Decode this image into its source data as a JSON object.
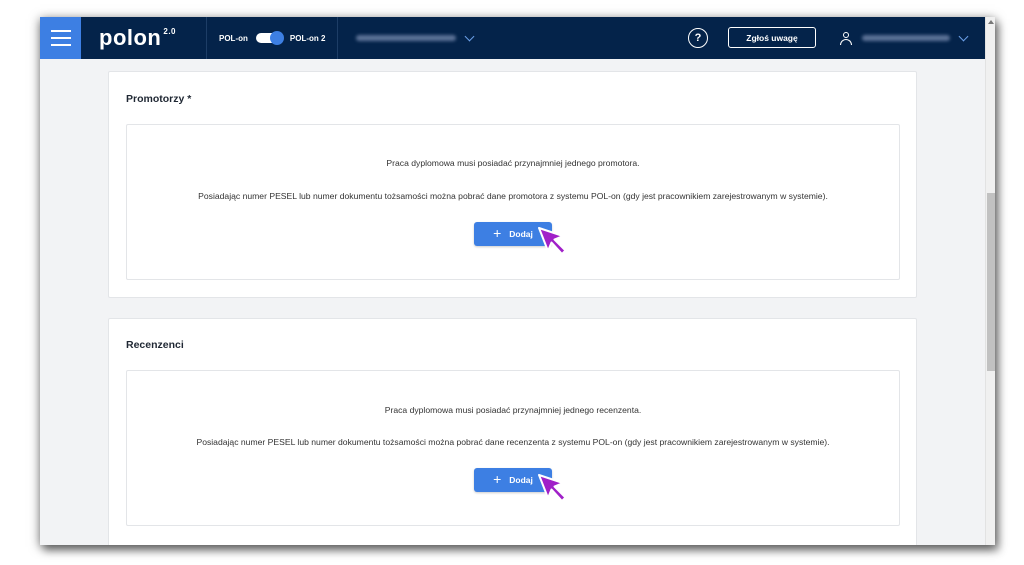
{
  "header": {
    "logo": "polon",
    "logo_version": "2.0",
    "toggle_left": "POL-on",
    "toggle_right": "POL-on 2",
    "help_glyph": "?",
    "report_label": "Zgłoś uwagę"
  },
  "sections": [
    {
      "title": "Promotorzy *",
      "line1": "Praca dyplomowa musi posiadać przynajmniej jednego promotora.",
      "line2": "Posiadając numer PESEL lub numer dokumentu tożsamości można pobrać dane promotora z systemu POL-on (gdy jest pracownikiem zarejestrowanym w systemie).",
      "button": "Dodaj"
    },
    {
      "title": "Recenzenci",
      "line1": "Praca dyplomowa musi posiadać przynajmniej jednego recenzenta.",
      "line2": "Posiadając numer PESEL lub numer dokumentu tożsamości można pobrać dane recenzenta z systemu POL-on (gdy jest pracownikiem zarejestrowanym w systemie).",
      "button": "Dodaj"
    }
  ],
  "colors": {
    "topbar": "#04234a",
    "accent": "#3d7fe3",
    "cursor": "#a020c8"
  },
  "icons": [
    "hamburger-menu-icon",
    "toggle-switch",
    "chevron-down-icon",
    "help-icon",
    "user-icon",
    "plus-icon",
    "pointer-cursor-icon"
  ]
}
